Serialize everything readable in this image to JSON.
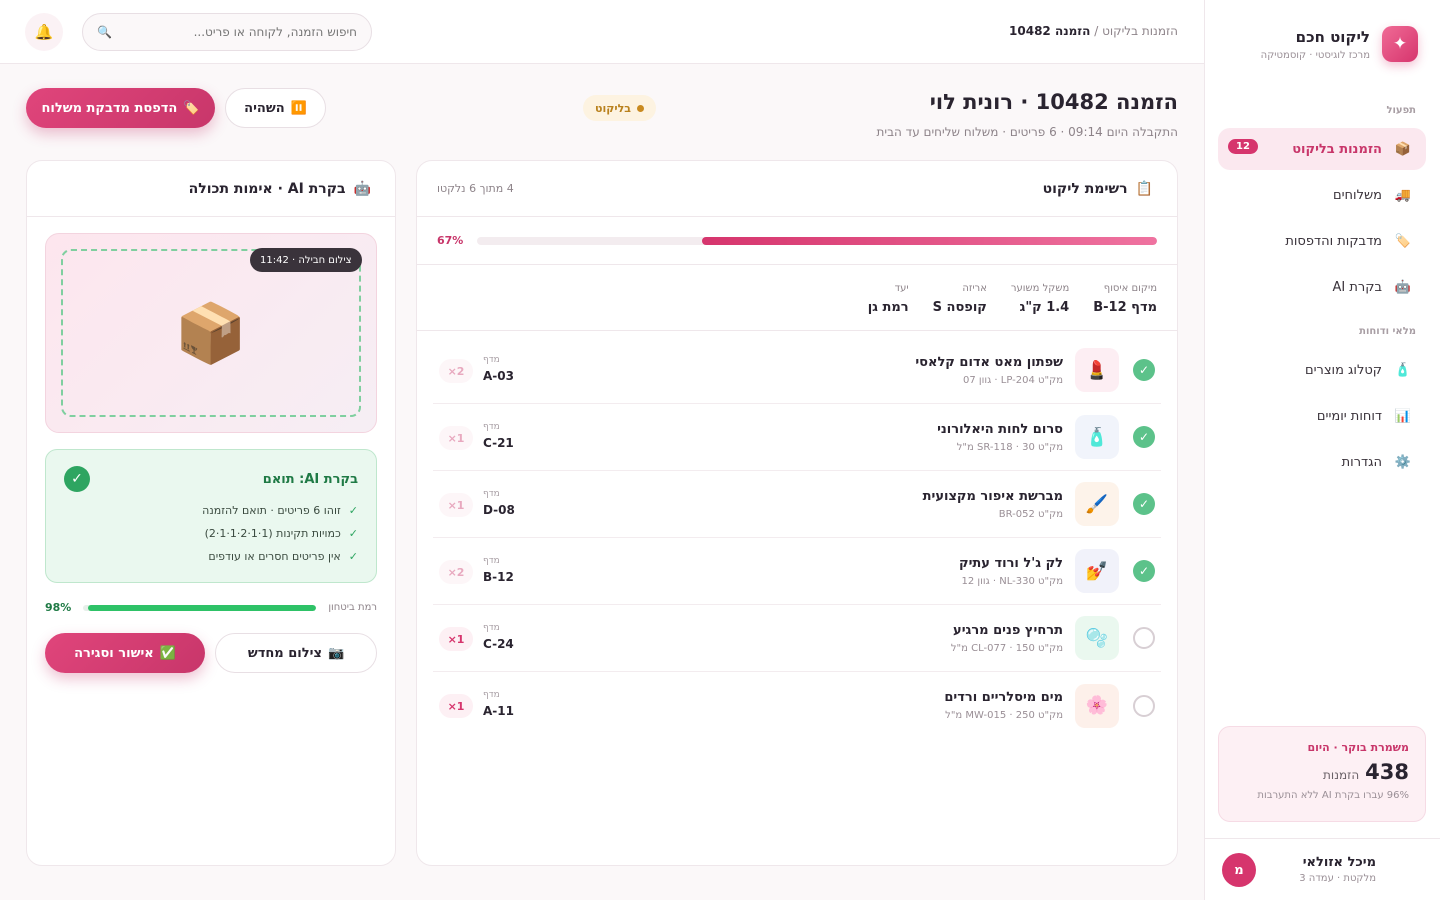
{
  "sidebar": {
    "brand": {
      "name": "ליקוט חכם",
      "subtitle": "מרכז לוגיסטי · קוסמטיקה",
      "logo_icon": "✦"
    },
    "section_ops": "תפעול",
    "section_inventory": "מלאי ודוחות",
    "items": [
      {
        "label": "הזמנות בליקוט",
        "icon": "📦",
        "badge": "12"
      },
      {
        "label": "משלוחים",
        "icon": "🚚"
      },
      {
        "label": "מדבקות והדפסות",
        "icon": "🏷️"
      },
      {
        "label": "בקרת AI",
        "icon": "🤖"
      },
      {
        "label": "קטלוג מוצרים",
        "icon": "🧴"
      },
      {
        "label": "דוחות יומיים",
        "icon": "📊"
      },
      {
        "label": "הגדרות",
        "icon": "⚙️"
      }
    ],
    "shift": {
      "label": "משמרת בוקר · היום",
      "count": "438",
      "unit": "הזמנות",
      "note": "96% עברו בקרת AI ללא התערבות"
    },
    "user": {
      "name": "מיכל אזולאי",
      "role": "מלקטת · עמדה 3",
      "initial": "מ"
    }
  },
  "topbar": {
    "crumb_parent": "הזמנות בליקוט",
    "crumb_sep": "/",
    "crumb_current": "הזמנה 10482",
    "search_placeholder": "חיפוש הזמנה, לקוחה או פריט...",
    "search_icon": "🔍",
    "notif_icon": "🔔"
  },
  "order": {
    "title": "הזמנה 10482 · רונית לוי",
    "meta": "התקבלה היום 09:14 · 6 פריטים · משלוח שליחים עד הבית",
    "status": "בליקוט",
    "status_color": "#c98a1f",
    "print_label": "הדפסת מדבקת משלוח",
    "print_icon": "🏷️",
    "pause_label": "השהיה",
    "pause_icon": "⏸️"
  },
  "picklist": {
    "title": "רשימת ליקוט",
    "title_icon": "📋",
    "counter": "4 מתוך 6 נלקטו",
    "progress": 67,
    "progress_label": "67%",
    "specs": [
      {
        "label": "מיקום איסוף",
        "value": "מדף B-12"
      },
      {
        "label": "משקל משוער",
        "value": "1.4 ק\"ג"
      },
      {
        "label": "אריזה",
        "value": "קופסה S"
      },
      {
        "label": "יעד",
        "value": "רמת גן"
      }
    ],
    "shelf_label": "מדף",
    "rows": [
      {
        "name": "שפתון מאט אדום קלאסי",
        "sku": "מק\"ט LP-204 · גוון 07",
        "shelf": "A-03",
        "qty": "2×",
        "done": true,
        "icon": "💄",
        "thumb_bg": "#fdeef3"
      },
      {
        "name": "סרום לחות היאלורוני",
        "sku": "מק\"ט SR-118 · 30 מ\"ל",
        "shelf": "C-21",
        "qty": "1×",
        "done": true,
        "icon": "🧴",
        "thumb_bg": "#f1f4fb"
      },
      {
        "name": "מברשת איפור מקצועית",
        "sku": "מק\"ט BR-052",
        "shelf": "D-08",
        "qty": "1×",
        "done": true,
        "icon": "🖌️",
        "thumb_bg": "#fdf3ea"
      },
      {
        "name": "לק ג'ל ורוד עתיק",
        "sku": "מק\"ט NL-330 · גוון 12",
        "shelf": "B-12",
        "qty": "2×",
        "done": true,
        "icon": "💅",
        "thumb_bg": "#f1f2fa"
      },
      {
        "name": "תרחיץ פנים מרגיע",
        "sku": "מק\"ט CL-077 · 150 מ\"ל",
        "shelf": "C-24",
        "qty": "1×",
        "done": false,
        "icon": "🫧",
        "thumb_bg": "#eaf8ef"
      },
      {
        "name": "מים מיסלריים ורדים",
        "sku": "מק\"ט MW-015 · 250 מ\"ל",
        "shelf": "A-11",
        "qty": "1×",
        "done": false,
        "icon": "🌸",
        "thumb_bg": "#fdf0ea"
      }
    ]
  },
  "ai": {
    "title": "בקרת AI · אימות תכולה",
    "title_icon": "🤖",
    "photo_tag": "צילום חבילה · 11:42",
    "photo_icon": "📦",
    "verdict": "בקרת AI: תואם",
    "checks": [
      "זוהו 6 פריטים · תואם להזמנה",
      "כמויות תקינות (1·1·2·1·1·2)",
      "אין פריטים חסרים או עודפים"
    ],
    "tick": "✓",
    "confidence_label": "רמת ביטחון",
    "confidence": 98,
    "confidence_text": "98%",
    "approve_label": "אישור וסגירה",
    "approve_icon": "✅",
    "retake_label": "צילום מחדש",
    "retake_icon": "📷"
  },
  "colors": {
    "accent": "#d6356d",
    "success": "#2ea561",
    "warning": "#c98a1f"
  }
}
